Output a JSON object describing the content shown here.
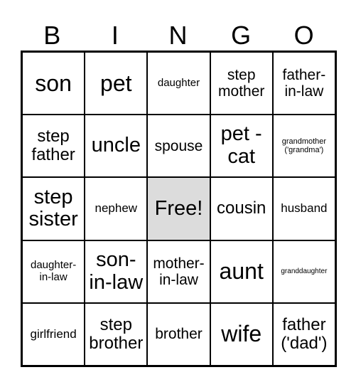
{
  "title_letters": [
    "B",
    "I",
    "N",
    "G",
    "O"
  ],
  "cells": [
    [
      "son",
      "pet",
      "daughter",
      "step\nmother",
      "father-\nin-law"
    ],
    [
      "step\nfather",
      "uncle",
      "spouse",
      "pet -\ncat",
      "grandmother\n('grandma')"
    ],
    [
      "step\nsister",
      "nephew",
      "Free!",
      "cousin",
      "husband"
    ],
    [
      "daughter-\nin-law",
      "son-\nin-law",
      "mother-\nin-law",
      "aunt",
      "granddaughter"
    ],
    [
      "girlfriend",
      "step\nbrother",
      "brother",
      "wife",
      "father\n('dad')"
    ]
  ],
  "free_cell_color": "#dcdcdc"
}
